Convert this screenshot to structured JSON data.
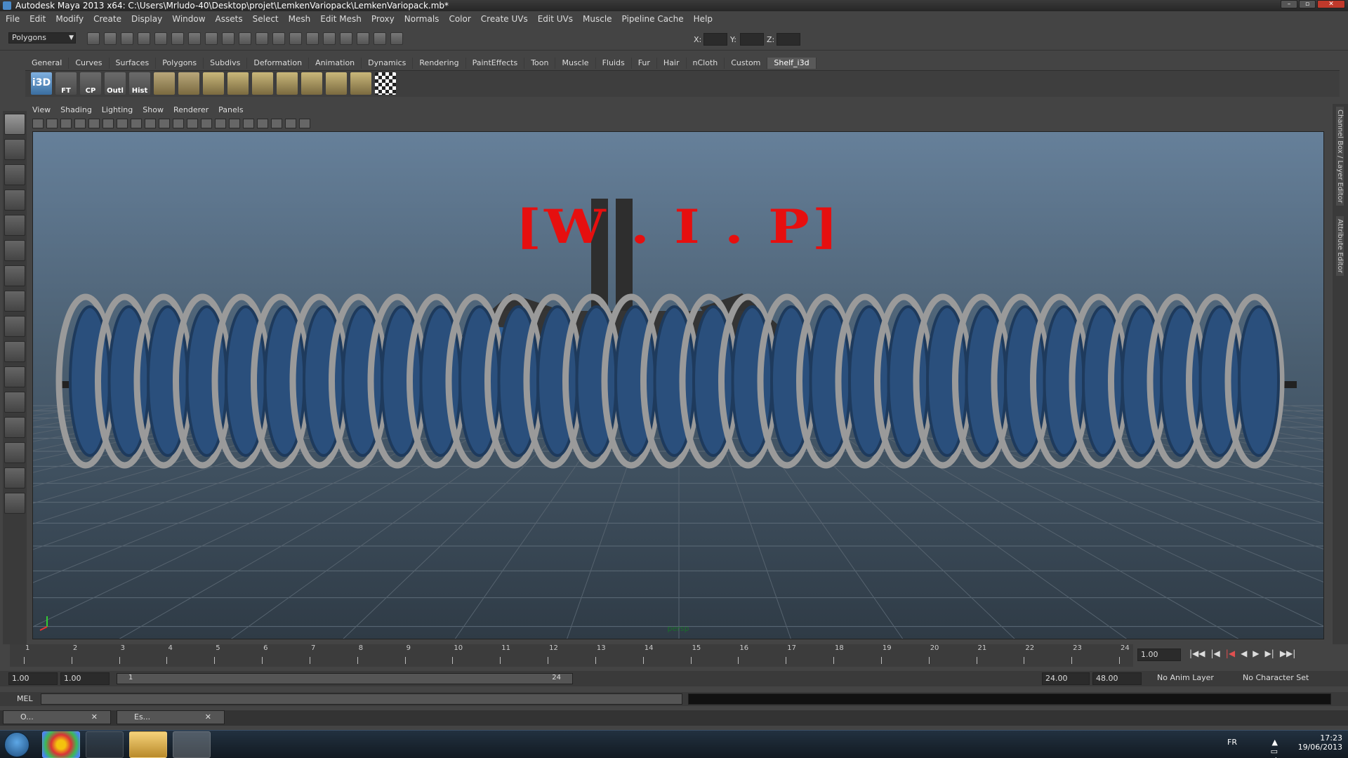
{
  "window": {
    "title": "Autodesk Maya 2013 x64: C:\\Users\\Mrludo-40\\Desktop\\projet\\LemkenVariopack\\LemkenVariopack.mb*"
  },
  "menubar": [
    "File",
    "Edit",
    "Modify",
    "Create",
    "Display",
    "Window",
    "Assets",
    "Select",
    "Mesh",
    "Edit Mesh",
    "Proxy",
    "Normals",
    "Color",
    "Create UVs",
    "Edit UVs",
    "Muscle",
    "Pipeline Cache",
    "Help"
  ],
  "toolbar": {
    "mode": "Polygons",
    "x_label": "X:",
    "y_label": "Y:",
    "z_label": "Z:"
  },
  "shelf": {
    "tabs": [
      "General",
      "Curves",
      "Surfaces",
      "Polygons",
      "Subdivs",
      "Deformation",
      "Animation",
      "Dynamics",
      "Rendering",
      "PaintEffects",
      "Toon",
      "Muscle",
      "Fluids",
      "Fur",
      "Hair",
      "nCloth",
      "Custom",
      "Shelf_i3d"
    ],
    "active_tab": "Shelf_i3d",
    "buttons": [
      "i3D",
      "FT",
      "CP",
      "Outl",
      "Hist"
    ]
  },
  "panel": {
    "menu": [
      "View",
      "Shading",
      "Lighting",
      "Show",
      "Renderer",
      "Panels"
    ],
    "camera": "persp"
  },
  "viewport": {
    "overlay_text": "[W . I . P]",
    "overlay_color": "#e60f0f"
  },
  "side_tabs": [
    "Channel Box / Layer Editor",
    "Attribute Editor"
  ],
  "timeline": {
    "ticks": [
      "1",
      "2",
      "3",
      "4",
      "5",
      "6",
      "7",
      "8",
      "9",
      "10",
      "11",
      "12",
      "13",
      "14",
      "15",
      "16",
      "17",
      "18",
      "19",
      "20",
      "21",
      "22",
      "23",
      "24"
    ],
    "current_frame": "1.00"
  },
  "range": {
    "start_time": "1.00",
    "playback_start": "1.00",
    "slider_start": "1",
    "slider_end": "24",
    "playback_end": "24.00",
    "end_time": "48.00",
    "anim_layer": "No Anim Layer",
    "char_set": "No Character Set"
  },
  "mel": {
    "label": "MEL"
  },
  "minimized": [
    {
      "title": "O..."
    },
    {
      "title": "Es..."
    }
  ],
  "tray": {
    "lang": "FR",
    "time": "17:23",
    "date": "19/06/2013"
  }
}
